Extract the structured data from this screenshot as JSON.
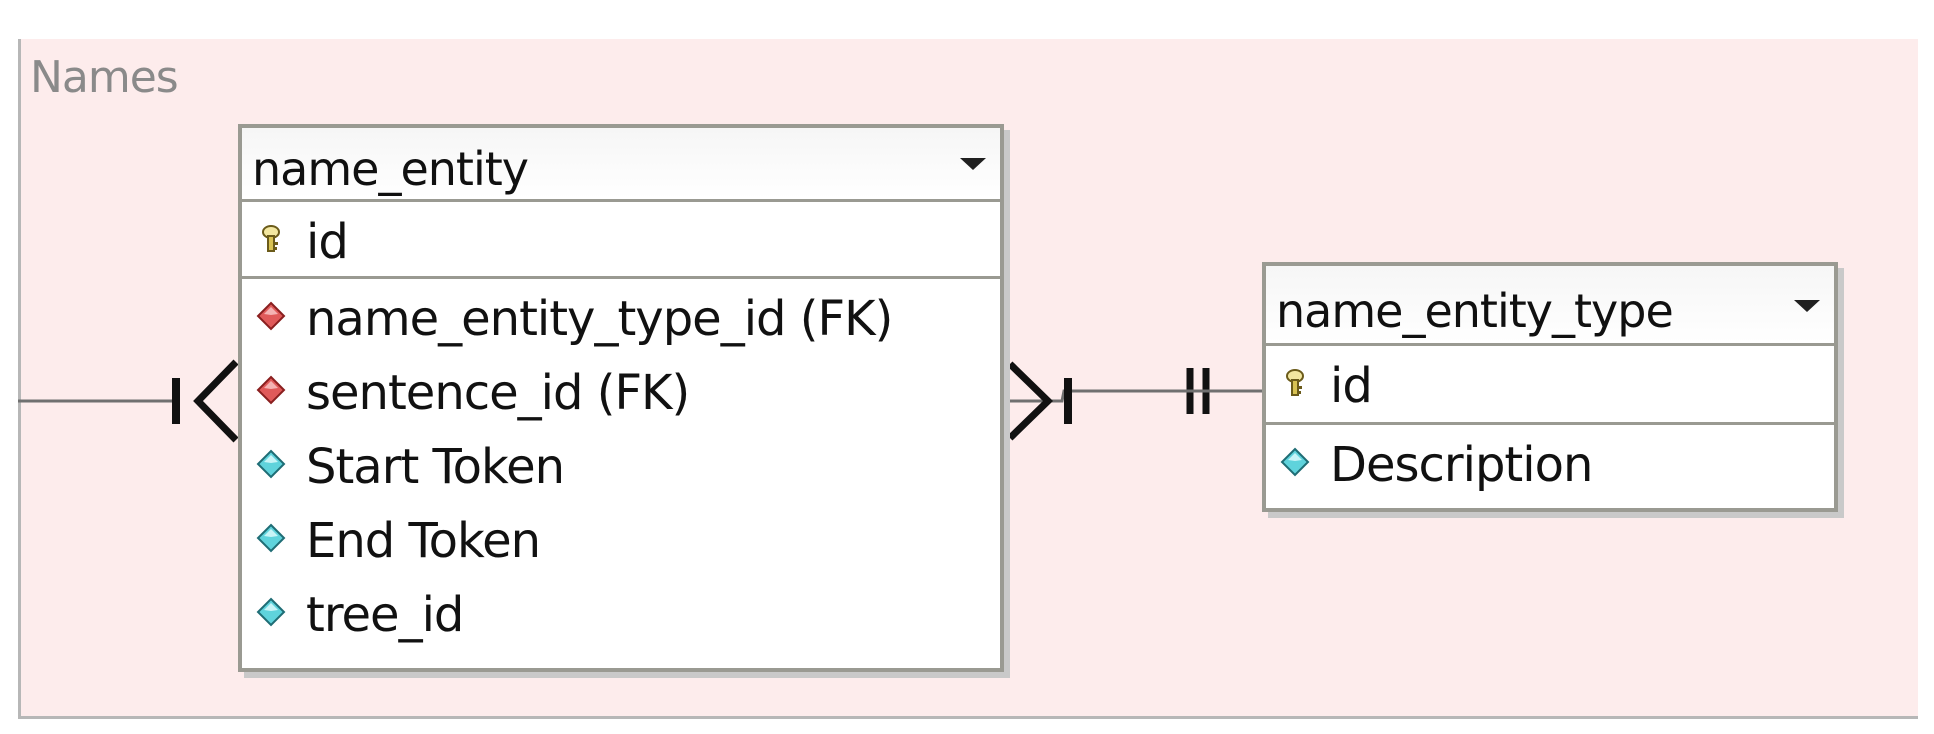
{
  "group": {
    "label": "Names"
  },
  "tables": {
    "name_entity": {
      "title": "name_entity",
      "pk_rows": [
        {
          "text": "id",
          "icon": "key-icon"
        }
      ],
      "rows": [
        {
          "text": "name_entity_type_id (FK)",
          "icon": "foreign-key-diamond-icon"
        },
        {
          "text": "sentence_id (FK)",
          "icon": "foreign-key-diamond-icon"
        },
        {
          "text": "Start Token",
          "icon": "attribute-diamond-icon"
        },
        {
          "text": "End Token",
          "icon": "attribute-diamond-icon"
        },
        {
          "text": "tree_id",
          "icon": "attribute-diamond-icon"
        }
      ]
    },
    "name_entity_type": {
      "title": "name_entity_type",
      "pk_rows": [
        {
          "text": "id",
          "icon": "key-icon"
        }
      ],
      "rows": [
        {
          "text": "Description",
          "icon": "attribute-diamond-icon"
        }
      ]
    }
  },
  "relationships": [
    {
      "from": "external",
      "to": "name_entity",
      "notation": "one-and-only-one to one-or-many"
    },
    {
      "from": "name_entity_type",
      "to": "name_entity",
      "notation": "one-and-only-one to one-or-many"
    }
  ],
  "colors": {
    "group_background": "#fdecec",
    "fk_diamond": "#e05a5a",
    "attribute_diamond": "#5fd3dc",
    "key": "#c9b13b",
    "line": "#707070"
  }
}
